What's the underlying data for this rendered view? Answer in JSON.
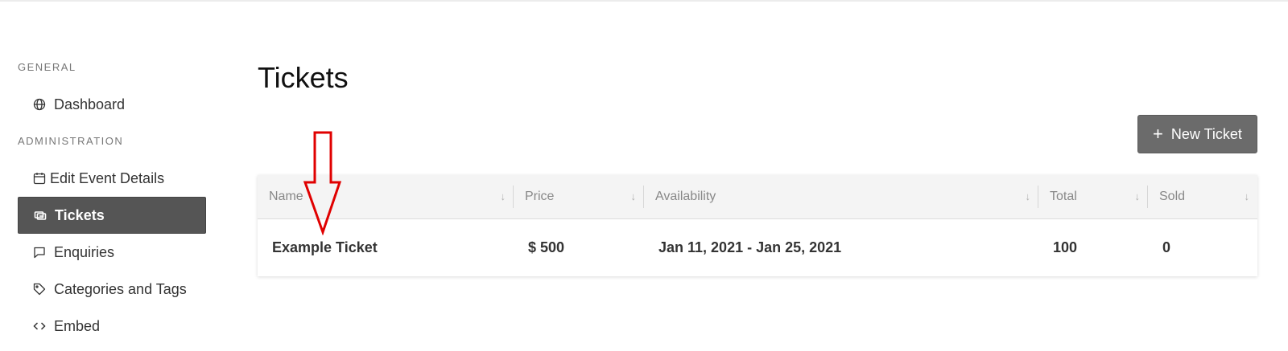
{
  "sidebar": {
    "sections": [
      {
        "label": "GENERAL"
      },
      {
        "label": "ADMINISTRATION"
      }
    ],
    "items": [
      {
        "label": "Dashboard",
        "icon": "globe-icon"
      },
      {
        "label": "Edit Event Details",
        "icon": "calendar-icon"
      },
      {
        "label": "Tickets",
        "icon": "ticket-icon",
        "active": true
      },
      {
        "label": "Enquiries",
        "icon": "chat-icon"
      },
      {
        "label": "Categories and Tags",
        "icon": "tag-icon"
      },
      {
        "label": "Embed",
        "icon": "code-icon"
      }
    ]
  },
  "main": {
    "title": "Tickets",
    "new_button": {
      "label": "New Ticket",
      "icon": "plus-icon"
    },
    "table": {
      "columns": [
        "Name",
        "Price",
        "Availability",
        "Total",
        "Sold"
      ],
      "sort_icon": "↓",
      "rows": [
        {
          "name": "Example Ticket",
          "price": "$ 500",
          "availability": "Jan 11, 2021 - Jan 25, 2021",
          "total": "100",
          "sold": "0"
        }
      ]
    }
  },
  "annotation": {
    "type": "red-arrow",
    "color": "#e00000"
  },
  "colors": {
    "active_nav_bg": "#555555",
    "button_bg": "#6b6b6b",
    "header_bg": "#f4f4f4"
  }
}
